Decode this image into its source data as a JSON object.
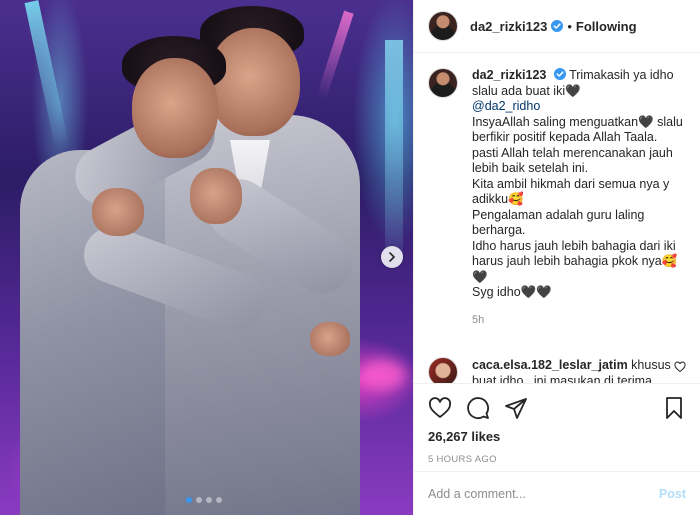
{
  "post": {
    "username": "da2_rizki123",
    "separator": "•",
    "follow_status": "Following",
    "caption_lines": [
      "Trimakasih ya idho",
      "slalu ada buat iki🖤",
      "@da2_ridho",
      "InsyaAllah saling menguatkan🖤 slalu",
      "berfikir positif kepada Allah Taala.",
      "pasti Allah telah merencanakan jauh",
      "lebih baik setelah ini.",
      "Kita ambil hikmah dari semua nya y",
      "adikku🥰",
      "Pengalaman adalah guru laling",
      "berharga.",
      "Idho harus jauh lebih bahagia dari iki",
      "harus jauh lebih bahagia pkok nya🥰",
      "🖤",
      "Syg idho🖤🖤"
    ],
    "caption_time": "5h",
    "comment": {
      "username": "caca.elsa.182_leslar_jatim",
      "text_line1": "khusus",
      "text_line2": "buat idho , ini masukan di terima"
    },
    "likes": "26,267 likes",
    "posted": "5 HOURS AGO",
    "add_comment_placeholder": "Add a comment...",
    "post_button": "Post"
  },
  "carousel": {
    "dots": 4,
    "active_index": 0
  },
  "icons": {
    "verified": "verified-badge-icon",
    "like": "heart-icon",
    "comment": "comment-bubble-icon",
    "share": "paper-plane-icon",
    "save": "bookmark-icon",
    "next": "chevron-right-icon"
  },
  "colors": {
    "verified_blue": "#3897f0",
    "link": "#00376b",
    "muted": "#8e8e8e",
    "post_button_disabled": "#b2dffc"
  }
}
